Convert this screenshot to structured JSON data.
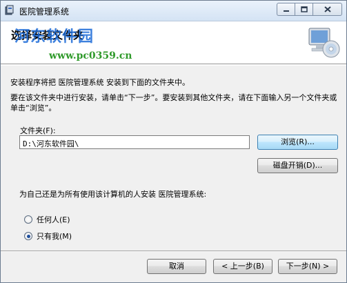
{
  "window": {
    "title": "医院管理系统",
    "controls": {
      "minimize": "minimize",
      "maximize": "maximize",
      "close": "close"
    }
  },
  "banner": {
    "heading": "选择安装文件夹",
    "watermark": "河东软件园",
    "watermark_url": "www.pc0359.cn"
  },
  "body": {
    "intro": "安装程序将把 医院管理系统 安装到下面的文件夹中。",
    "instruction": "要在该文件夹中进行安装，请单击“下一步”。要安装到其他文件夹，请在下面输入另一个文件夹或单击“浏览”。",
    "folder_label": "文件夹(F):",
    "folder_value": "D:\\河东软件园\\",
    "browse_label": "浏览(R)...",
    "disk_cost_label": "磁盘开销(D)...",
    "question": "为自己还是为所有使用该计算机的人安装 医院管理系统:",
    "options": [
      {
        "label": "任何人(E)",
        "checked": false
      },
      {
        "label": "只有我(M)",
        "checked": true
      }
    ]
  },
  "footer": {
    "cancel_label": "取消",
    "back_label": "< 上一步(B)",
    "next_label": "下一步(N) >"
  },
  "colors": {
    "accent": "#3c7fb1",
    "watermark_blue": "#1c6bd8",
    "watermark_green": "#2f9a2a"
  }
}
